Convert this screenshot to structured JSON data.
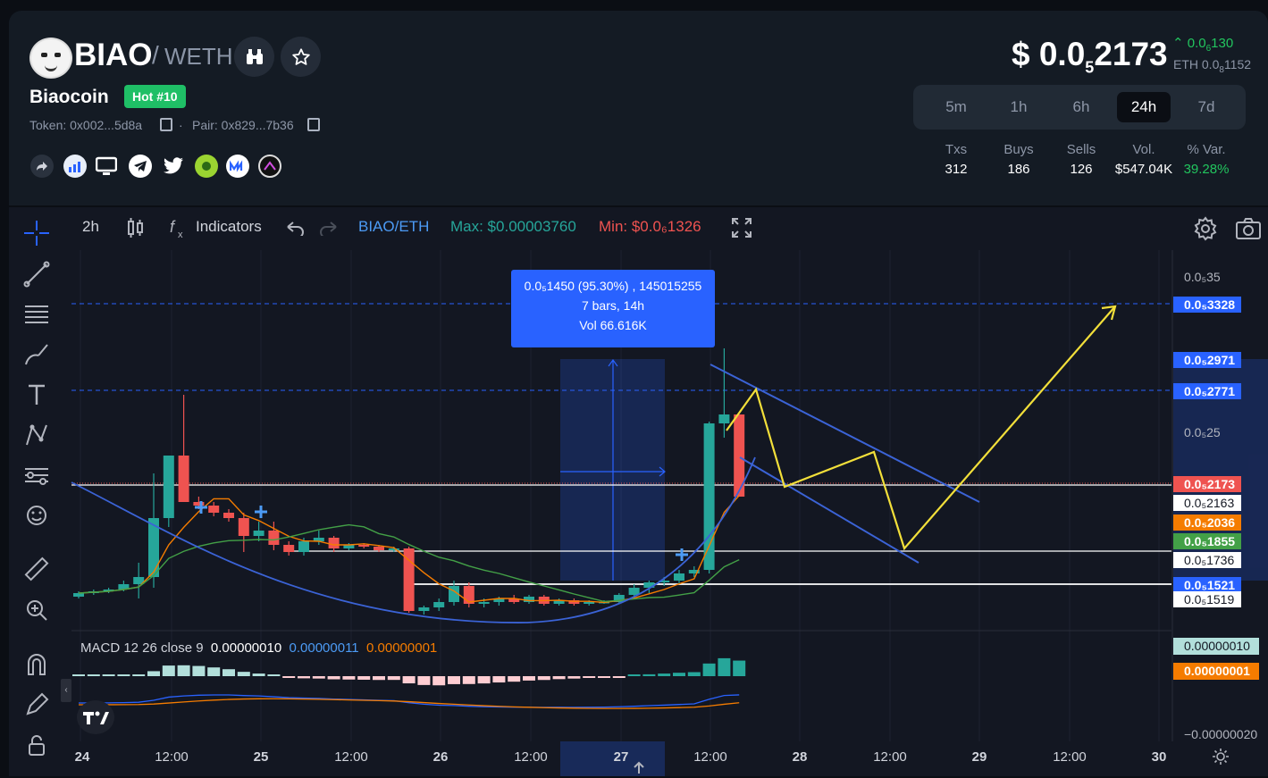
{
  "header": {
    "base_symbol": "BIAO",
    "separator": "/",
    "quote_symbol": "WETH",
    "token_name": "Biaocoin",
    "hot_badge": "Hot #10",
    "token_label": "Token: 0x002...5d8a",
    "pair_label": "Pair: 0x829...7b36",
    "dot": "·",
    "social_icons": [
      "share-icon",
      "chart-stats-icon",
      "website-icon",
      "telegram-icon",
      "twitter-icon",
      "dextools-icon",
      "coinmarketcap-icon",
      "dexscreener-icon"
    ]
  },
  "price": {
    "prefix": "$ 0.0",
    "sub": "5",
    "rest": "2173",
    "change_prefix": "0.0",
    "change_sub": "6",
    "change_rest": "130",
    "change_color": "#22c55e",
    "eth_prefix": "ETH 0.0",
    "eth_sub": "8",
    "eth_rest": "1152"
  },
  "timeframes": {
    "options": [
      "5m",
      "1h",
      "6h",
      "24h",
      "7d"
    ],
    "selected": "24h"
  },
  "stats": [
    {
      "label": "Txs",
      "value": "312"
    },
    {
      "label": "Buys",
      "value": "186"
    },
    {
      "label": "Sells",
      "value": "126"
    },
    {
      "label": "Vol.",
      "value": "$547.04K"
    },
    {
      "label": "% Var.",
      "value": "39.28%",
      "color": "#22c55e"
    }
  ],
  "toolbar": {
    "interval": "2h",
    "indicators": "Indicators",
    "symbol": "BIAO/ETH",
    "max": "Max: $0.00003760",
    "min": "Min: $0.0₆1326"
  },
  "measure_box": {
    "line1": "0.0₅1450 (95.30%) , 145015255",
    "line2": "7 bars, 14h",
    "line3": "Vol 66.616K"
  },
  "macd_legend": {
    "name": "MACD 12 26 close 9",
    "v1": "0.00000010",
    "v2": "0.00000011",
    "v3": "0.00000001"
  },
  "y_axis": {
    "ticks": [
      "0.0₅35",
      "0.0₅25"
    ],
    "tags": [
      {
        "text": "0.0₅3328",
        "color": "#2962ff"
      },
      {
        "text": "0.0₅2971",
        "color": "#2962ff"
      },
      {
        "text": "0.0₅2771",
        "color": "#2962ff"
      },
      {
        "text": "0.0₅2173",
        "color": "#ef5350"
      },
      {
        "text": "0.0₅2163",
        "color": "#ffffff"
      },
      {
        "text": "0.0₅2036",
        "color": "#f57c00"
      },
      {
        "text": "0.0₅1855",
        "color": "#43a047"
      },
      {
        "text": "0.0₅1736",
        "color": "#ffffff"
      },
      {
        "text": "0.0₅1521",
        "color": "#2962ff"
      },
      {
        "text": "0.0₅1519",
        "color": "#ffffff"
      }
    ],
    "macd_tags": [
      {
        "text": "0.00000010",
        "color": "#b2dfdb"
      },
      {
        "text": "0.00000001",
        "color": "#f57c00"
      }
    ],
    "macd_bottom": "−0.00000020"
  },
  "x_axis": {
    "labels": [
      "24",
      "12:00",
      "25",
      "12:00",
      "26",
      "12:00",
      "27",
      "12:00",
      "28",
      "12:00",
      "29",
      "12:00",
      "30"
    ]
  },
  "chart_data": {
    "type": "candlestick",
    "title": "BIAO/ETH",
    "interval": "2h",
    "candles": [
      [
        1.61,
        1.64,
        1.6,
        1.63
      ],
      [
        1.63,
        1.65,
        1.62,
        1.64
      ],
      [
        1.64,
        1.66,
        1.63,
        1.65
      ],
      [
        1.65,
        1.7,
        1.64,
        1.68
      ],
      [
        1.68,
        1.8,
        1.6,
        1.72
      ],
      [
        1.72,
        2.3,
        1.66,
        2.05
      ],
      [
        2.05,
        2.35,
        2.0,
        2.4
      ],
      [
        2.4,
        2.74,
        2.28,
        2.14
      ],
      [
        2.14,
        2.17,
        2.1,
        2.12
      ],
      [
        2.12,
        2.14,
        2.06,
        2.08
      ],
      [
        2.08,
        2.1,
        2.03,
        2.05
      ],
      [
        2.05,
        2.08,
        1.86,
        1.95
      ],
      [
        1.95,
        2.03,
        1.92,
        1.98
      ],
      [
        1.98,
        2.03,
        1.87,
        1.9
      ],
      [
        1.9,
        1.92,
        1.84,
        1.86
      ],
      [
        1.86,
        1.94,
        1.84,
        1.92
      ],
      [
        1.92,
        1.98,
        1.9,
        1.94
      ],
      [
        1.94,
        1.95,
        1.86,
        1.88
      ],
      [
        1.88,
        1.91,
        1.87,
        1.9
      ],
      [
        1.9,
        1.91,
        1.88,
        1.89
      ],
      [
        1.89,
        1.9,
        1.86,
        1.87
      ],
      [
        1.87,
        1.89,
        1.86,
        1.88
      ],
      [
        1.88,
        1.89,
        1.52,
        1.53
      ],
      [
        1.53,
        1.56,
        1.51,
        1.55
      ],
      [
        1.55,
        1.6,
        1.53,
        1.58
      ],
      [
        1.58,
        1.7,
        1.56,
        1.67
      ],
      [
        1.67,
        1.69,
        1.55,
        1.57
      ],
      [
        1.57,
        1.6,
        1.55,
        1.58
      ],
      [
        1.58,
        1.61,
        1.56,
        1.6
      ],
      [
        1.6,
        1.62,
        1.57,
        1.58
      ],
      [
        1.58,
        1.62,
        1.57,
        1.61
      ],
      [
        1.61,
        1.62,
        1.56,
        1.57
      ],
      [
        1.57,
        1.6,
        1.56,
        1.59
      ],
      [
        1.59,
        1.6,
        1.56,
        1.57
      ],
      [
        1.57,
        1.59,
        1.56,
        1.58
      ],
      [
        1.58,
        1.59,
        1.57,
        1.58
      ],
      [
        1.58,
        1.63,
        1.57,
        1.62
      ],
      [
        1.62,
        1.68,
        1.6,
        1.66
      ],
      [
        1.66,
        1.7,
        1.63,
        1.69
      ],
      [
        1.69,
        1.72,
        1.67,
        1.7
      ],
      [
        1.7,
        1.76,
        1.68,
        1.74
      ],
      [
        1.74,
        1.78,
        1.72,
        1.76
      ],
      [
        1.76,
        2.59,
        1.74,
        2.58
      ],
      [
        2.58,
        3.0,
        2.5,
        2.63
      ],
      [
        2.63,
        2.63,
        2.18,
        2.17
      ]
    ],
    "visible_price_range": [
      1.45,
      3.55
    ],
    "price_unit": "×1e-5 ETH"
  }
}
